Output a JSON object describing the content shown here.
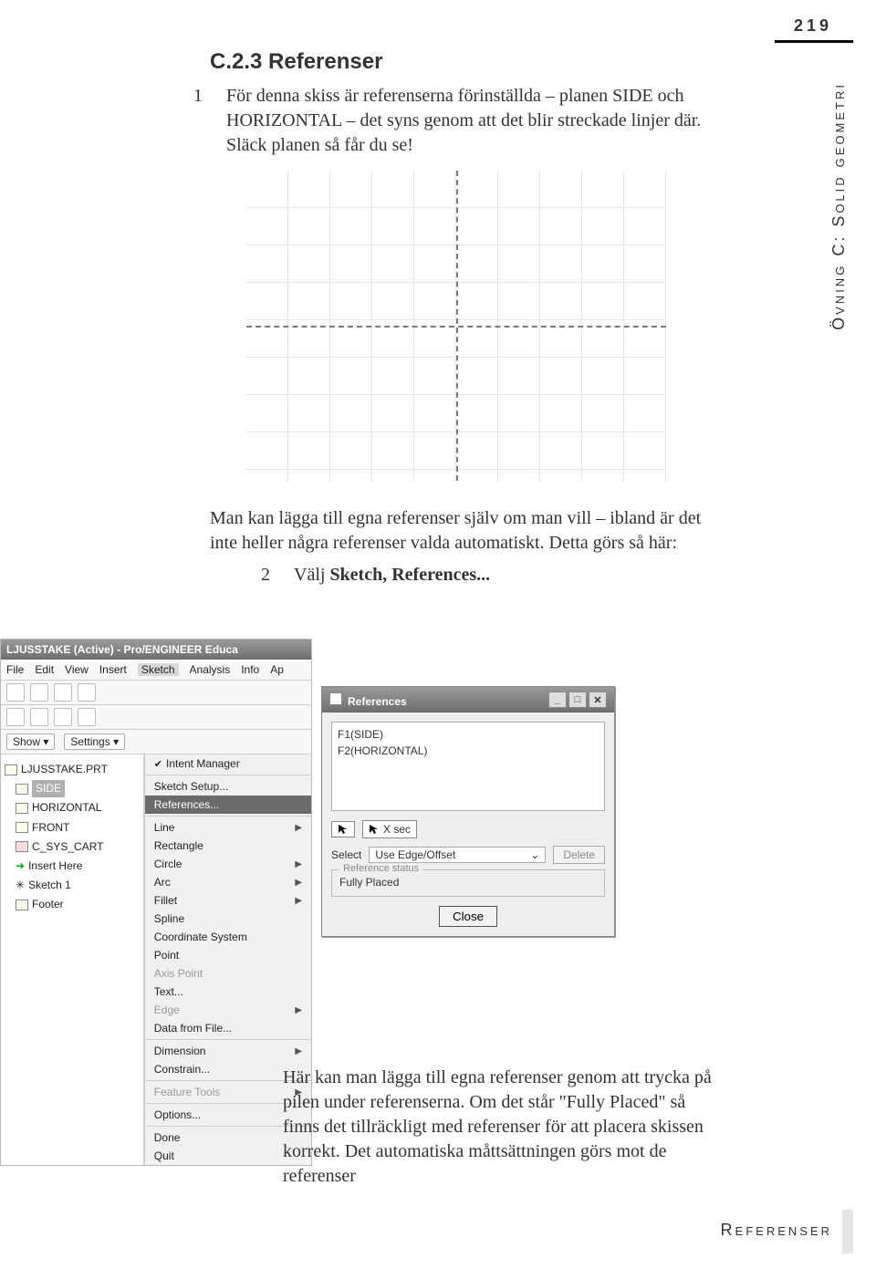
{
  "page_number": "219",
  "side_label": "Övning C: Solid geometri",
  "heading": "C.2.3  Referenser",
  "step1_num": "1",
  "step1_text": "För denna skiss är referenserna förinställda – planen SIDE och HORIZONTAL – det syns genom att det blir streckade linjer där. Släck planen så får du se!",
  "para_mid": "Man kan lägga till egna referenser själv om man vill – ibland är det inte heller några referenser valda automatiskt. Detta görs så här:",
  "step2_num": "2",
  "step2_prefix": "Välj ",
  "step2_bold": "Sketch, References...",
  "proe": {
    "title": "LJUSSTAKE (Active) - Pro/ENGINEER Educa",
    "menus": [
      "File",
      "Edit",
      "View",
      "Insert",
      "Sketch",
      "Analysis",
      "Info",
      "Ap"
    ],
    "show": "Show ▾",
    "settings": "Settings ▾",
    "tree": {
      "root": "LJUSSTAKE.PRT",
      "items": [
        "SIDE",
        "HORIZONTAL",
        "FRONT",
        "C_SYS_CART",
        "Insert Here",
        "Sketch 1",
        "Footer"
      ]
    },
    "sketch_menu": {
      "intent": "Intent Manager",
      "setup": "Sketch Setup...",
      "references": "References...",
      "line": "Line",
      "rectangle": "Rectangle",
      "circle": "Circle",
      "arc": "Arc",
      "fillet": "Fillet",
      "spline": "Spline",
      "coord": "Coordinate System",
      "point": "Point",
      "axispoint": "Axis Point",
      "text": "Text...",
      "edge": "Edge",
      "datafile": "Data from File...",
      "dimension": "Dimension",
      "constrain": "Constrain...",
      "feattools": "Feature Tools",
      "options": "Options...",
      "done": "Done",
      "quit": "Quit"
    }
  },
  "refs_dialog": {
    "title": "References",
    "items": [
      "F1(SIDE)",
      "F2(HORIZONTAL)"
    ],
    "xsec_btn": "X sec",
    "select_label": "Select",
    "select_option": "Use Edge/Offset",
    "delete_btn": "Delete",
    "status_legend": "Reference status",
    "status_value": "Fully Placed",
    "close_btn": "Close"
  },
  "para_below": "Här kan man lägga till egna referenser genom att trycka på pilen under referenserna. Om det står \"Fully Placed\" så finns det tillräckligt med referenser för att placera skissen korrekt. Det automatiska måttsättningen görs mot de referenser",
  "footer_label": "Referenser"
}
